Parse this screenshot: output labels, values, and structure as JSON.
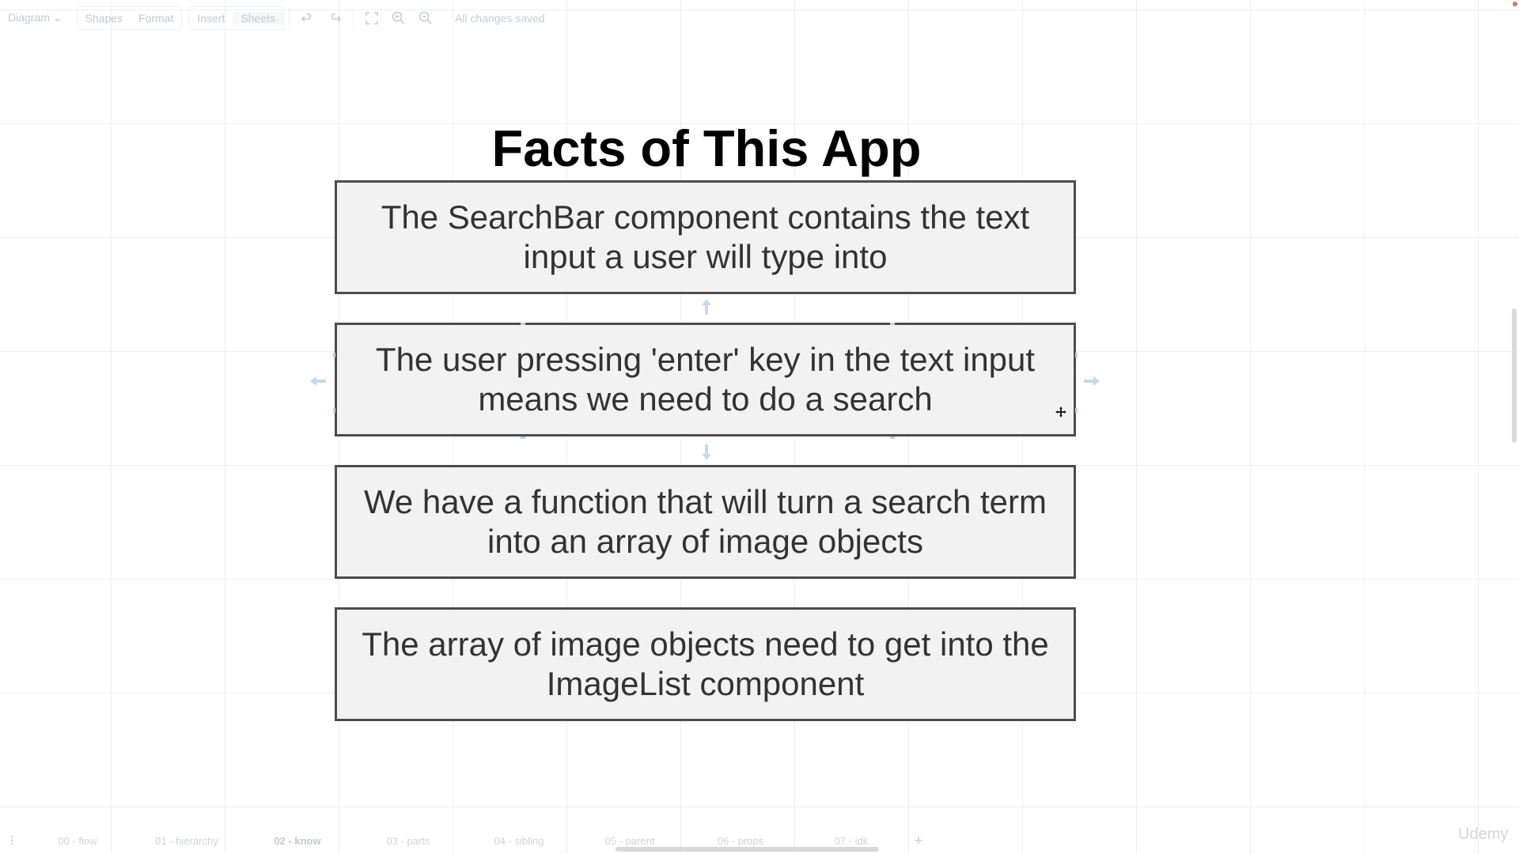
{
  "toolbar": {
    "diagram_label": "Diagram",
    "shapes_label": "Shapes",
    "format_label": "Format",
    "insert_label": "Insert",
    "sheets_label": "Sheets",
    "status": "All changes saved"
  },
  "diagram": {
    "title": "Facts of This App",
    "facts": [
      "The SearchBar component contains the text input a user will type into",
      "The user pressing 'enter' key in the text input means we need to do a search",
      "We have a function that will turn a search term into an array of image objects",
      "The array of image objects need to get into the ImageList component"
    ]
  },
  "page_tabs": [
    "00 - flow",
    "01 - hierarchy",
    "02 - know",
    "03 - parts",
    "04 - sibling",
    "05 - parent",
    "06 - props",
    "07 - idk"
  ],
  "active_tab_index": 2,
  "watermark": "Udemy",
  "colors": {
    "box_fill": "#f2f2f2",
    "box_border": "#4d4d4d",
    "text": "#333333",
    "handle": "#b9cfe8"
  }
}
